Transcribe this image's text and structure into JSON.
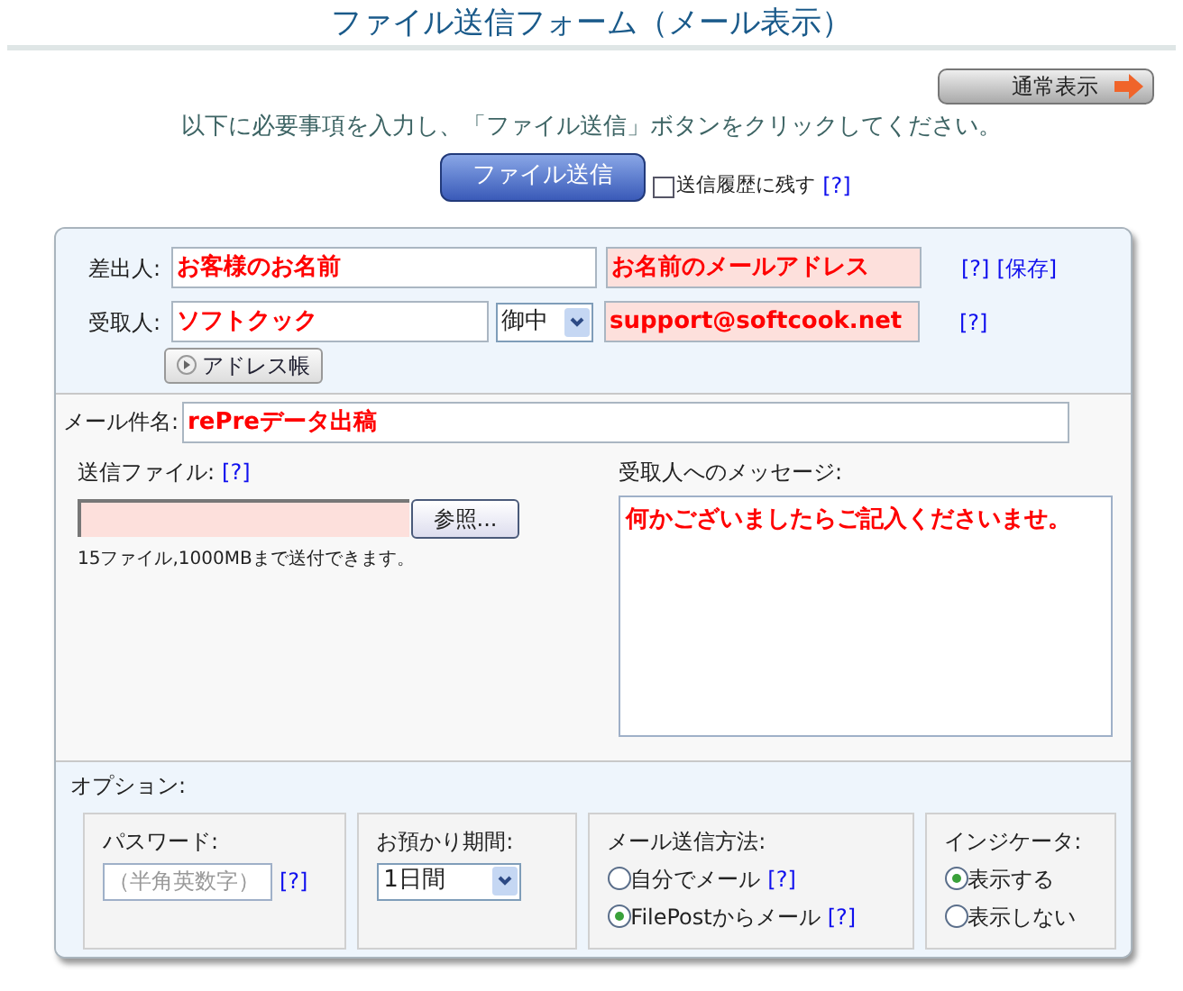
{
  "title": "ファイル送信フォーム（メール表示）",
  "view_button": "通常表示",
  "instruction": "以下に必要事項を入力し、「ファイル送信」ボタンをクリックしてください。",
  "send_button": "ファイル送信",
  "history_checkbox": {
    "label": "送信履歴に残す",
    "checked": false,
    "help": "[?]"
  },
  "sender": {
    "label": "差出人:",
    "name": "お客様のお名前",
    "email": "お名前のメールアドレス",
    "help": "[?]",
    "save": "[保存]"
  },
  "recipient": {
    "label": "受取人:",
    "name": "ソフトクック",
    "honorific": "御中",
    "email": "support@softcook.net",
    "help": "[?]",
    "address_book": "アドレス帳"
  },
  "subject": {
    "label": "メール件名:",
    "value": "rePreデータ出稿"
  },
  "file": {
    "label": "送信ファイル:",
    "help": "[?]",
    "browse": "参照...",
    "note": "15ファイル,1000MBまで送付できます。"
  },
  "message": {
    "label": "受取人へのメッセージ:",
    "value": "何かございましたらご記入くださいませ。"
  },
  "options": {
    "label": "オプション:",
    "password": {
      "label": "パスワード:",
      "placeholder": "（半角英数字）",
      "help": "[?]"
    },
    "period": {
      "label": "お預かり期間:",
      "value": "1日間"
    },
    "mail_method": {
      "label": "メール送信方法:",
      "choices": [
        {
          "label": "自分でメール",
          "selected": false,
          "help": "[?]"
        },
        {
          "label": "FilePostからメール",
          "selected": true,
          "help": "[?]"
        }
      ]
    },
    "indicator": {
      "label": "インジケータ:",
      "choices": [
        {
          "label": "表示する",
          "selected": true
        },
        {
          "label": "表示しない",
          "selected": false
        }
      ]
    }
  }
}
